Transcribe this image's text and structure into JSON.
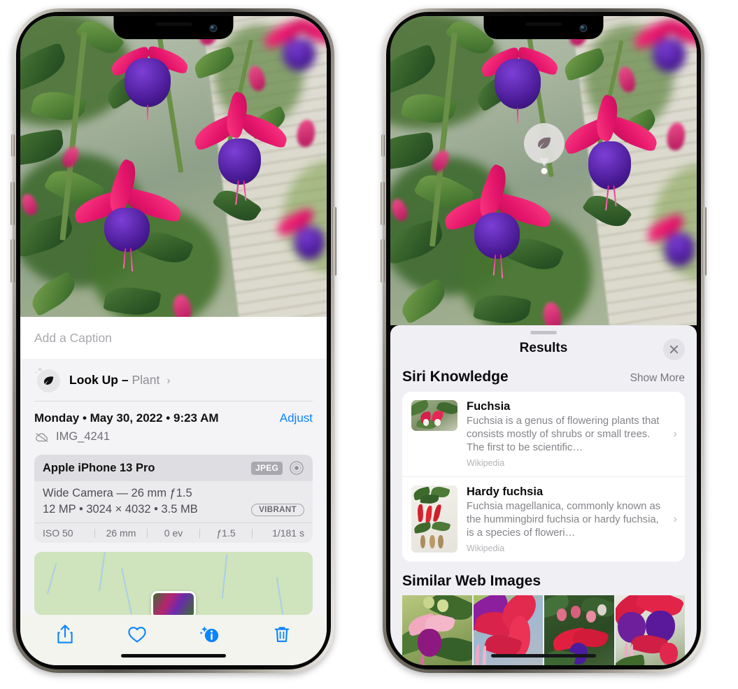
{
  "left_phone": {
    "photo": {
      "alt_name": "fuchsia-flowers-photo"
    },
    "caption_field": {
      "placeholder": "Add a Caption",
      "value": ""
    },
    "lookup_row": {
      "icon": "leaf-icon",
      "sparkle_icon": "sparkles-icon",
      "label": "Look Up –",
      "subject": "Plant",
      "chevron": "›"
    },
    "metadata": {
      "date_line": "Monday • May 30, 2022 • 9:23 AM",
      "adjust_label": "Adjust",
      "cloud_icon": "cloud-slash-icon",
      "filename": "IMG_4241"
    },
    "camera_card": {
      "device": "Apple iPhone 13 Pro",
      "format_badge": "JPEG",
      "lens_icon": "aperture-icon",
      "lens_line": "Wide Camera — 26 mm ƒ1.5",
      "size_line": "12 MP • 3024 × 4032 • 3.5 MB",
      "style_badge": "VIBRANT",
      "exif": [
        "ISO 50",
        "26 mm",
        "0 ev",
        "ƒ1.5",
        "1/181 s"
      ]
    },
    "map_card": {
      "name": "location-map",
      "pin": "photo-thumbnail-pin"
    },
    "toolbar": [
      {
        "name": "share-button",
        "icon": "share-icon"
      },
      {
        "name": "favorite-button",
        "icon": "heart-icon"
      },
      {
        "name": "info-button",
        "icon": "info-sparkle-icon"
      },
      {
        "name": "delete-button",
        "icon": "trash-icon"
      }
    ]
  },
  "right_phone": {
    "photo": {
      "alt_name": "fuchsia-flowers-photo"
    },
    "lookup_badge": {
      "icon": "leaf-icon"
    },
    "sheet": {
      "grabber": "drag-handle",
      "title": "Results",
      "close_icon": "close-x-icon"
    },
    "siri_knowledge": {
      "title": "Siri Knowledge",
      "show_more": "Show More",
      "entries": [
        {
          "title": "Fuchsia",
          "description": "Fuchsia is a genus of flowering plants that consists mostly of shrubs or small trees. The first to be scientific…",
          "source": "Wikipedia",
          "thumb": "fuchsia-thumbnail",
          "chevron": "›"
        },
        {
          "title": "Hardy fuchsia",
          "description": "Fuchsia magellanica, commonly known as the hummingbird fuchsia or hardy fuchsia, is a species of floweri…",
          "source": "Wikipedia",
          "thumb": "hardy-fuchsia-thumbnail",
          "chevron": "›"
        }
      ]
    },
    "similar_web_images": {
      "title": "Similar Web Images",
      "thumbnails": [
        {
          "name": "web-image-1"
        },
        {
          "name": "web-image-2"
        },
        {
          "name": "web-image-3"
        },
        {
          "name": "web-image-4"
        }
      ]
    }
  },
  "colors": {
    "accent_blue": "#0a84ff",
    "sheet_bg": "#f4f4f6",
    "results_bg": "#f0eff4",
    "card_white": "#ffffff",
    "secondary_text": "#8e8e93",
    "badge_gray": "#a9a9b0"
  }
}
